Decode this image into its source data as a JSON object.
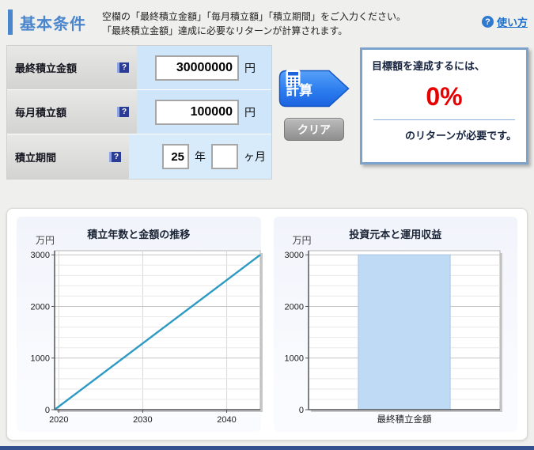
{
  "header": {
    "title": "基本条件",
    "instructions_line1": "空欄の「最終積立金額」「毎月積立額」「積立期間」をご入力ください。",
    "instructions_line2": "「最終積立金額」達成に必要なリターンが計算されます。",
    "help_icon": "?",
    "help_link": "使い方"
  },
  "form": {
    "help_icon": "?",
    "rows": [
      {
        "label": "最終積立金額",
        "value": "30000000",
        "unit": "円"
      },
      {
        "label": "毎月積立額",
        "value": "100000",
        "unit": "円"
      },
      {
        "label": "積立期間",
        "years": "25",
        "years_unit": "年",
        "months": "",
        "months_unit": "ヶ月"
      }
    ]
  },
  "buttons": {
    "calculate": "計算",
    "clear": "クリア"
  },
  "result": {
    "line1": "目標額を達成するには、",
    "value": "0%",
    "line2": "のリターンが必要です。",
    "value_color": "#e60000"
  },
  "chart_data": [
    {
      "type": "line",
      "title": "積立年数と金額の推移",
      "unit_label": "万円",
      "x": [
        2019.5,
        2044
      ],
      "y": [
        0,
        3000
      ],
      "xlim": [
        2019.5,
        2044
      ],
      "ylim": [
        0,
        3080
      ],
      "xticks": [
        2020,
        2030,
        2040
      ],
      "yticks": [
        0,
        1000,
        2000,
        3000
      ],
      "minor_y_step": 200,
      "grid": true,
      "line_color": "#2d9ac3"
    },
    {
      "type": "bar",
      "title": "投資元本と運用収益",
      "unit_label": "万円",
      "categories": [
        "最終積立金額"
      ],
      "values": [
        3000
      ],
      "ylim": [
        0,
        3080
      ],
      "yticks": [
        0,
        1000,
        2000,
        3000
      ],
      "minor_y_step": 200,
      "grid": true,
      "bar_width_frac": 0.48,
      "bar_color": "#bfdaf4",
      "bar_border": "#a5c6e4"
    }
  ],
  "colors": {
    "accent_blue": "#4b86cc",
    "link_blue": "#1a6ecc",
    "calc_button_blue": "#2b7ff0",
    "clear_button_gray": "#9a9a9a",
    "result_border": "#7ba3cc",
    "result_red": "#e60000",
    "form_value_bg": "#cfe6fa",
    "help_icon_bg": "#2b3c96"
  }
}
